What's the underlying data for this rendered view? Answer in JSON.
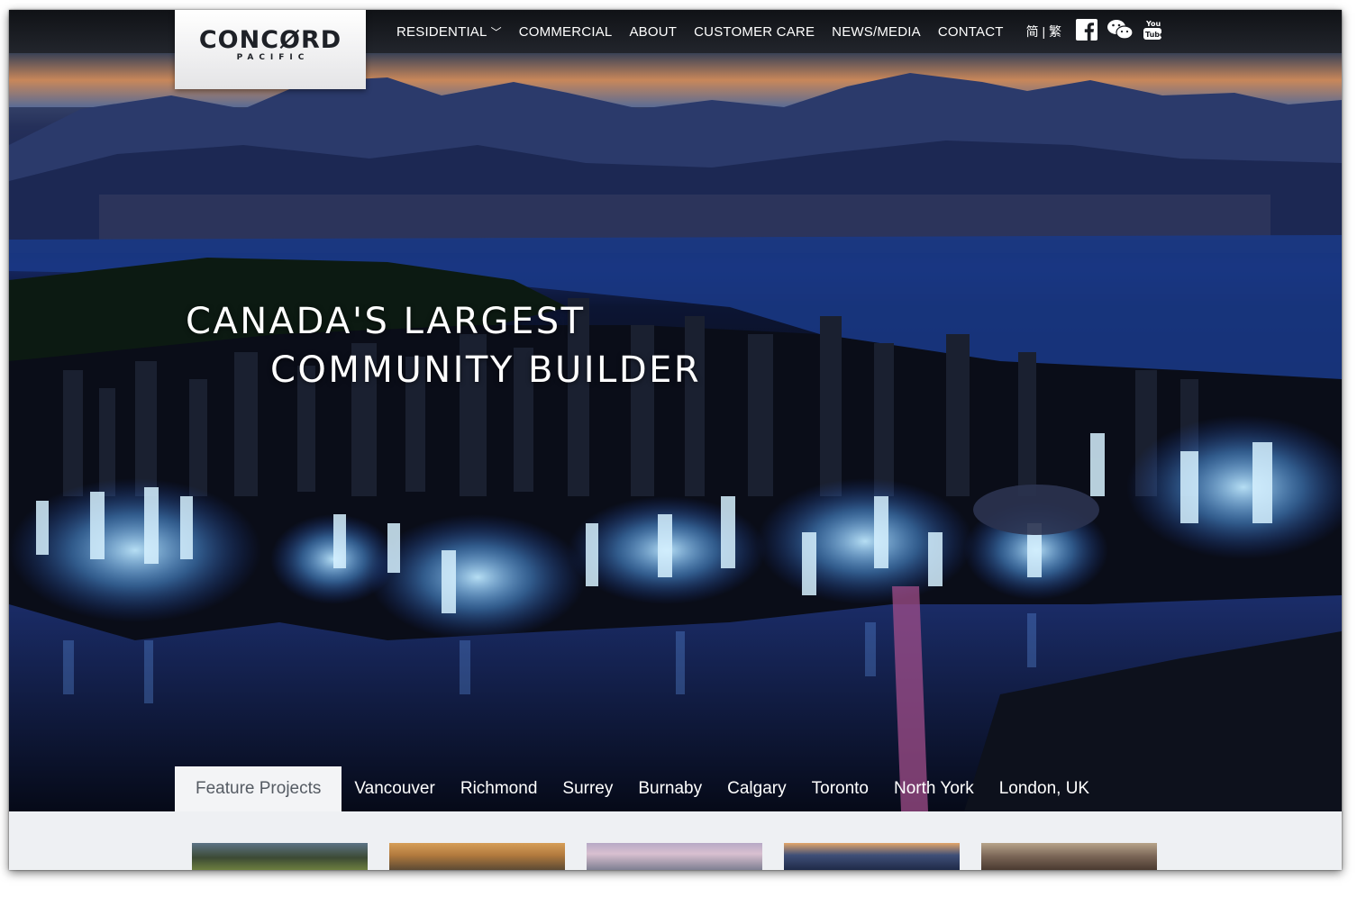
{
  "logo": {
    "main": "CONCØRD",
    "sub": "PACIFIC"
  },
  "nav": {
    "items": [
      {
        "label": "RESIDENTIAL",
        "has_dropdown": true
      },
      {
        "label": "COMMERCIAL"
      },
      {
        "label": "ABOUT"
      },
      {
        "label": "CUSTOMER CARE"
      },
      {
        "label": "NEWS/MEDIA"
      },
      {
        "label": "CONTACT"
      }
    ],
    "dropdown_icon": "double-chevron-down",
    "language": "简 | 繁",
    "social": [
      "facebook-icon",
      "wechat-icon",
      "youtube-icon"
    ]
  },
  "hero": {
    "headline_line1": "CANADA'S LARGEST",
    "headline_line2": "COMMUNITY BUILDER"
  },
  "tabs": {
    "items": [
      "Feature Projects",
      "Vancouver",
      "Richmond",
      "Surrey",
      "Burnaby",
      "Calgary",
      "Toronto",
      "North York",
      "London, UK"
    ],
    "active": "Feature Projects"
  },
  "colors": {
    "nav_bg": "#1a1c21",
    "active_tab_bg": "#f3f4f6",
    "glow": "#8fd4ff"
  },
  "project_cards_count": 5
}
